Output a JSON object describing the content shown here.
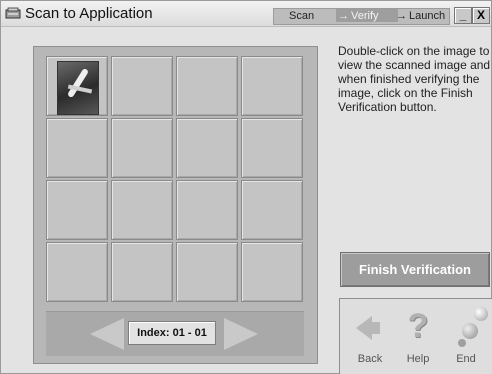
{
  "window": {
    "title": "Scan to Application",
    "steps": [
      "Scan",
      "Verify",
      "Launch"
    ],
    "active_step": "Verify",
    "minimize_label": "_",
    "close_label": "X"
  },
  "grid": {
    "rows": 4,
    "columns": 4,
    "thumbnail_cell": 0,
    "index_label": "Index: 01 - 01"
  },
  "instructions": "Double-click on the image to view the scanned image and when finished verifying the image, click on the Finish Verification button.",
  "finish_button": "Finish Verification",
  "bottom_buttons": {
    "back": "Back",
    "help": "Help",
    "end": "End"
  },
  "icons": [
    "scanner-icon",
    "back-arrow-icon",
    "help-question-icon",
    "end-spheres-icon",
    "left-arrow-icon",
    "right-arrow-icon"
  ],
  "colors": {
    "background": "#e3e3e3",
    "panel": "#b7b7b7",
    "finish_button": "#9d9d9d"
  }
}
